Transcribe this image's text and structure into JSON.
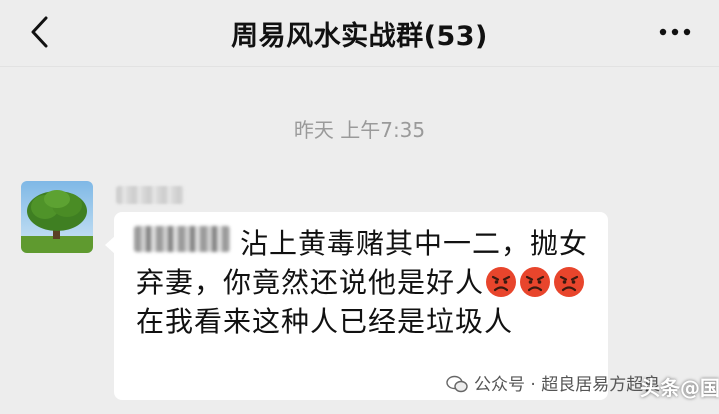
{
  "header": {
    "title": "周易风水实战群(53)",
    "back_icon": "chevron-left-icon",
    "more_icon": "ellipsis-icon"
  },
  "chat": {
    "timestamp": "昨天 上午7:35",
    "message": {
      "part1": "沾上黄毒赌其中一二，抛女弃妻，你竟然还说他是好人",
      "part2": "在我看来这种人已经是垃圾人",
      "emoji": "angry-face-icon"
    }
  },
  "watermark": {
    "text": "公众号 · 超良居易方超良",
    "overlay": "头条@国学"
  },
  "colors": {
    "background": "#ededed",
    "bubble": "#ffffff",
    "timestamp": "#9a9a9a",
    "emoji_red": "#e8452c"
  }
}
